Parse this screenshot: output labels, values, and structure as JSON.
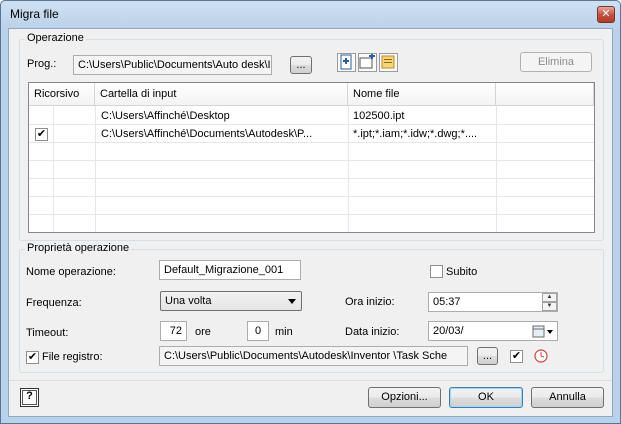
{
  "window": {
    "title": "Migra file",
    "close_glyph": "✕"
  },
  "operation_group": {
    "label": "Operazione",
    "prog_label": "Prog.:",
    "prog_value": "C:\\Users\\Public\\Documents\\Auto desk\\Ir",
    "browse_label": "...",
    "icons": [
      "new-file-icon",
      "add-folder-icon",
      "folder-options-icon"
    ],
    "delete_label": "Elimina",
    "table": {
      "headers": [
        "Ricorsivo",
        "Cartella di input",
        "Nome file"
      ],
      "rows": [
        {
          "recursive": false,
          "folder": "C:\\Users\\Affinché\\Desktop",
          "file": "102500.ipt"
        },
        {
          "recursive": true,
          "folder": "C:\\Users\\Affinché\\Documents\\Autodesk\\P...",
          "file": "*.ipt;*.iam;*.idw;*.dwg;*...."
        }
      ]
    }
  },
  "properties_group": {
    "label": "Proprietà operazione",
    "name_label": "Nome operazione:",
    "name_value": "Default_Migrazione_001",
    "now_label": "Subito",
    "now_checked": false,
    "freq_label": "Frequenza:",
    "freq_value": "Una volta",
    "start_time_label": "Ora inizio:",
    "start_time_value": "05:37",
    "timeout_label": "Timeout:",
    "hours_value": "72",
    "hours_unit": "ore",
    "minutes_value": "0",
    "minutes_unit": "min",
    "start_date_label": "Data inizio:",
    "start_date_value": "20/03/",
    "log_label": "File registro:",
    "log_checked": true,
    "log_value": "C:\\Users\\Public\\Documents\\Autodesk\\Inventor        \\Task Sche",
    "log_browse_label": "...",
    "log_enable_checked": true
  },
  "footer": {
    "help_glyph": "?",
    "options_label": "Opzioni...",
    "ok_label": "OK",
    "cancel_label": "Annulla"
  },
  "check_glyph": "✔"
}
